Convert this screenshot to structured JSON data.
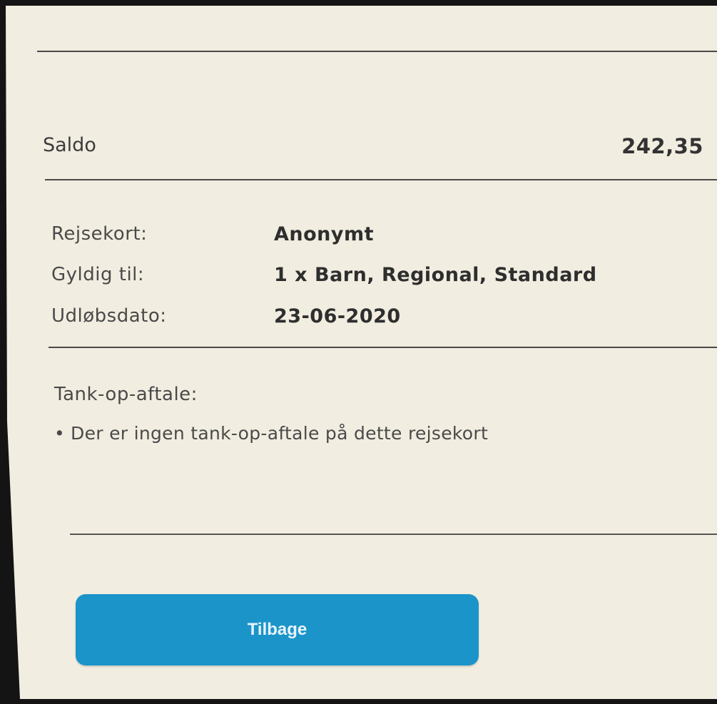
{
  "balance": {
    "label": "Saldo",
    "value": "242,35"
  },
  "card_info": [
    {
      "label": "Rejsekort:",
      "value": "Anonymt"
    },
    {
      "label": "Gyldig til:",
      "value": "1 x Barn, Regional, Standard"
    },
    {
      "label": "Udløbsdato:",
      "value": "23-06-2020"
    }
  ],
  "topup": {
    "label": "Tank-op-aftale:",
    "bullet": "•",
    "message": "Der er ingen tank-op-aftale på dette rejsekort"
  },
  "back_button": {
    "label": "Tilbage"
  },
  "colors": {
    "screen_background": "#f1ede0",
    "button": "#1b94c9",
    "bezel": "#141414"
  }
}
